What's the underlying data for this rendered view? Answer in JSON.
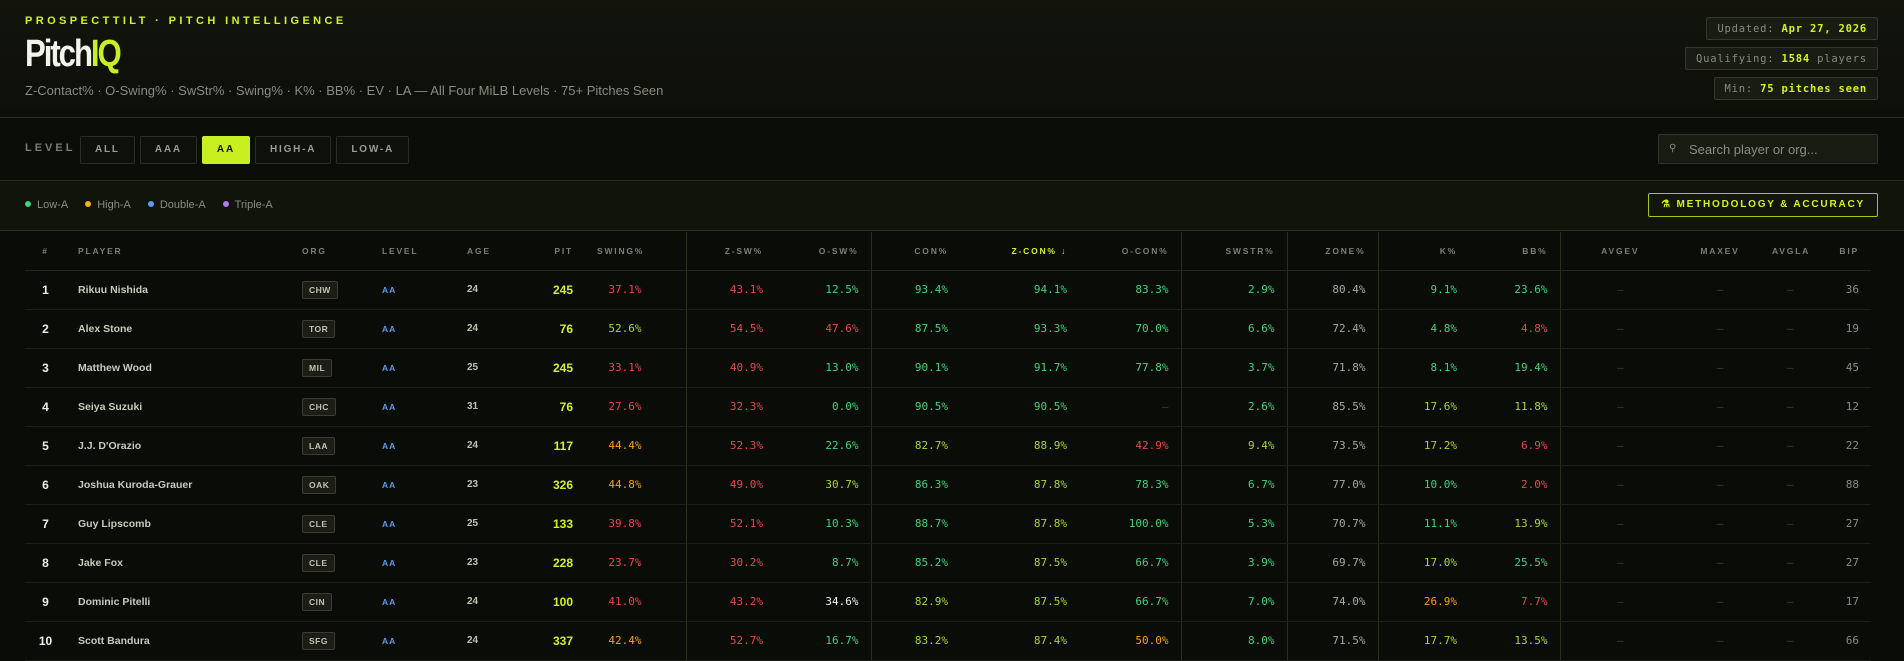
{
  "header": {
    "tagline": "PROSPECTTILT · PITCH INTELLIGENCE",
    "logo_main": "Pitch",
    "logo_accent": "IQ",
    "subtitle": "Z-Contact% · O-Swing% · SwStr% · Swing% · K% · BB% · EV · LA — All Four MiLB Levels · 75+ Pitches Seen",
    "badges": [
      {
        "label": "Updated:",
        "value": "Apr 27, 2026",
        "suffix": ""
      },
      {
        "label": "Qualifying:",
        "value": "1584",
        "suffix": "players"
      },
      {
        "label": "Min:",
        "value": "75 pitches seen",
        "suffix": ""
      }
    ]
  },
  "filters": {
    "level_label": "LEVEL",
    "levels": [
      "ALL",
      "AAA",
      "AA",
      "HIGH-A",
      "LOW-A"
    ],
    "active_level": "AA",
    "search_placeholder": "Search player or org...",
    "search_icon": "search-icon"
  },
  "legend": [
    {
      "label": "Low-A",
      "color": "#3fd27e"
    },
    {
      "label": "High-A",
      "color": "#f5b40b"
    },
    {
      "label": "Double-A",
      "color": "#5b9cf0"
    },
    {
      "label": "Triple-A",
      "color": "#b07af0"
    }
  ],
  "methodology_button": "⚗ METHODOLOGY & ACCURACY",
  "accent_color": "#c8f020",
  "table": {
    "columns": [
      "#",
      "PLAYER",
      "ORG",
      "LEVEL",
      "AGE",
      "PIT",
      "SWING%",
      "Z-SW%",
      "O-SW%",
      "CON%",
      "Z-CON% ↓",
      "O-CON%",
      "SWSTR%",
      "ZONE%",
      "K%",
      "BB%",
      "AVGEV",
      "MAXEV",
      "AVGLA",
      "BIP"
    ],
    "sorted_column": "Z-CON% ↓",
    "rows": [
      {
        "rank": "1",
        "player": "Rikuu Nishida",
        "org": "CHW",
        "level": "AA",
        "age": "24",
        "pit": "245",
        "swing": [
          "37.1%",
          "red"
        ],
        "zsw": [
          "43.1%",
          "red"
        ],
        "osw": [
          "12.5%",
          "green"
        ],
        "con": [
          "93.4%",
          "green"
        ],
        "zcon": [
          "94.1%",
          "green"
        ],
        "ocon": [
          "83.3%",
          "green"
        ],
        "swstr": [
          "2.9%",
          "green"
        ],
        "zone": [
          "80.4%",
          "gray"
        ],
        "k": [
          "9.1%",
          "green"
        ],
        "bb": [
          "23.6%",
          "green"
        ],
        "avgev": "–",
        "maxev": "–",
        "avgla": "–",
        "bip": "36"
      },
      {
        "rank": "2",
        "player": "Alex Stone",
        "org": "TOR",
        "level": "AA",
        "age": "24",
        "pit": "76",
        "swing": [
          "52.6%",
          "yg"
        ],
        "zsw": [
          "54.5%",
          "red"
        ],
        "osw": [
          "47.6%",
          "red"
        ],
        "con": [
          "87.5%",
          "green"
        ],
        "zcon": [
          "93.3%",
          "green"
        ],
        "ocon": [
          "70.0%",
          "green"
        ],
        "swstr": [
          "6.6%",
          "green"
        ],
        "zone": [
          "72.4%",
          "gray"
        ],
        "k": [
          "4.8%",
          "green"
        ],
        "bb": [
          "4.8%",
          "red"
        ],
        "avgev": "–",
        "maxev": "–",
        "avgla": "–",
        "bip": "19"
      },
      {
        "rank": "3",
        "player": "Matthew Wood",
        "org": "MIL",
        "level": "AA",
        "age": "25",
        "pit": "245",
        "swing": [
          "33.1%",
          "red"
        ],
        "zsw": [
          "40.9%",
          "red"
        ],
        "osw": [
          "13.0%",
          "green"
        ],
        "con": [
          "90.1%",
          "green"
        ],
        "zcon": [
          "91.7%",
          "green"
        ],
        "ocon": [
          "77.8%",
          "green"
        ],
        "swstr": [
          "3.7%",
          "green"
        ],
        "zone": [
          "71.8%",
          "gray"
        ],
        "k": [
          "8.1%",
          "green"
        ],
        "bb": [
          "19.4%",
          "green"
        ],
        "avgev": "–",
        "maxev": "–",
        "avgla": "–",
        "bip": "45"
      },
      {
        "rank": "4",
        "player": "Seiya Suzuki",
        "org": "CHC",
        "level": "AA",
        "age": "31",
        "pit": "76",
        "swing": [
          "27.6%",
          "red"
        ],
        "zsw": [
          "32.3%",
          "red"
        ],
        "osw": [
          "0.0%",
          "green"
        ],
        "con": [
          "90.5%",
          "green"
        ],
        "zcon": [
          "90.5%",
          "green"
        ],
        "ocon": [
          "–",
          "dim"
        ],
        "swstr": [
          "2.6%",
          "green"
        ],
        "zone": [
          "85.5%",
          "gray"
        ],
        "k": [
          "17.6%",
          "yg"
        ],
        "bb": [
          "11.8%",
          "yg"
        ],
        "avgev": "–",
        "maxev": "–",
        "avgla": "–",
        "bip": "12"
      },
      {
        "rank": "5",
        "player": "J.J. D'Orazio",
        "org": "LAA",
        "level": "AA",
        "age": "24",
        "pit": "117",
        "swing": [
          "44.4%",
          "orange"
        ],
        "zsw": [
          "52.3%",
          "red"
        ],
        "osw": [
          "22.6%",
          "green"
        ],
        "con": [
          "82.7%",
          "yg"
        ],
        "zcon": [
          "88.9%",
          "yg"
        ],
        "ocon": [
          "42.9%",
          "red"
        ],
        "swstr": [
          "9.4%",
          "yg"
        ],
        "zone": [
          "73.5%",
          "gray"
        ],
        "k": [
          "17.2%",
          "yg"
        ],
        "bb": [
          "6.9%",
          "red"
        ],
        "avgev": "–",
        "maxev": "–",
        "avgla": "–",
        "bip": "22"
      },
      {
        "rank": "6",
        "player": "Joshua Kuroda-Grauer",
        "org": "OAK",
        "level": "AA",
        "age": "23",
        "pit": "326",
        "swing": [
          "44.8%",
          "orange"
        ],
        "zsw": [
          "49.0%",
          "red"
        ],
        "osw": [
          "30.7%",
          "yg"
        ],
        "con": [
          "86.3%",
          "green"
        ],
        "zcon": [
          "87.8%",
          "yg"
        ],
        "ocon": [
          "78.3%",
          "green"
        ],
        "swstr": [
          "6.7%",
          "green"
        ],
        "zone": [
          "77.0%",
          "gray"
        ],
        "k": [
          "10.0%",
          "green"
        ],
        "bb": [
          "2.0%",
          "red"
        ],
        "avgev": "–",
        "maxev": "–",
        "avgla": "–",
        "bip": "88"
      },
      {
        "rank": "7",
        "player": "Guy Lipscomb",
        "org": "CLE",
        "level": "AA",
        "age": "25",
        "pit": "133",
        "swing": [
          "39.8%",
          "red"
        ],
        "zsw": [
          "52.1%",
          "red"
        ],
        "osw": [
          "10.3%",
          "green"
        ],
        "con": [
          "88.7%",
          "green"
        ],
        "zcon": [
          "87.8%",
          "yg"
        ],
        "ocon": [
          "100.0%",
          "green"
        ],
        "swstr": [
          "5.3%",
          "green"
        ],
        "zone": [
          "70.7%",
          "gray"
        ],
        "k": [
          "11.1%",
          "green"
        ],
        "bb": [
          "13.9%",
          "yg"
        ],
        "avgev": "–",
        "maxev": "–",
        "avgla": "–",
        "bip": "27"
      },
      {
        "rank": "8",
        "player": "Jake Fox",
        "org": "CLE",
        "level": "AA",
        "age": "23",
        "pit": "228",
        "swing": [
          "23.7%",
          "red"
        ],
        "zsw": [
          "30.2%",
          "red"
        ],
        "osw": [
          "8.7%",
          "green"
        ],
        "con": [
          "85.2%",
          "green"
        ],
        "zcon": [
          "87.5%",
          "yg"
        ],
        "ocon": [
          "66.7%",
          "green"
        ],
        "swstr": [
          "3.9%",
          "green"
        ],
        "zone": [
          "69.7%",
          "gray"
        ],
        "k": [
          "17.0%",
          "yg"
        ],
        "bb": [
          "25.5%",
          "green"
        ],
        "avgev": "–",
        "maxev": "–",
        "avgla": "–",
        "bip": "27"
      },
      {
        "rank": "9",
        "player": "Dominic Pitelli",
        "org": "CIN",
        "level": "AA",
        "age": "24",
        "pit": "100",
        "swing": [
          "41.0%",
          "red"
        ],
        "zsw": [
          "43.2%",
          "red"
        ],
        "osw": [
          "34.6%",
          "white"
        ],
        "con": [
          "82.9%",
          "yg"
        ],
        "zcon": [
          "87.5%",
          "yg"
        ],
        "ocon": [
          "66.7%",
          "green"
        ],
        "swstr": [
          "7.0%",
          "green"
        ],
        "zone": [
          "74.0%",
          "gray"
        ],
        "k": [
          "26.9%",
          "orange"
        ],
        "bb": [
          "7.7%",
          "red"
        ],
        "avgev": "–",
        "maxev": "–",
        "avgla": "–",
        "bip": "17"
      },
      {
        "rank": "10",
        "player": "Scott Bandura",
        "org": "SFG",
        "level": "AA",
        "age": "24",
        "pit": "337",
        "swing": [
          "42.4%",
          "orange"
        ],
        "zsw": [
          "52.7%",
          "red"
        ],
        "osw": [
          "16.7%",
          "green"
        ],
        "con": [
          "83.2%",
          "yg"
        ],
        "zcon": [
          "87.4%",
          "yg"
        ],
        "ocon": [
          "50.0%",
          "orange"
        ],
        "swstr": [
          "8.0%",
          "green"
        ],
        "zone": [
          "71.5%",
          "gray"
        ],
        "k": [
          "17.7%",
          "yg"
        ],
        "bb": [
          "13.5%",
          "yg"
        ],
        "avgev": "–",
        "maxev": "–",
        "avgla": "–",
        "bip": "66"
      }
    ]
  }
}
